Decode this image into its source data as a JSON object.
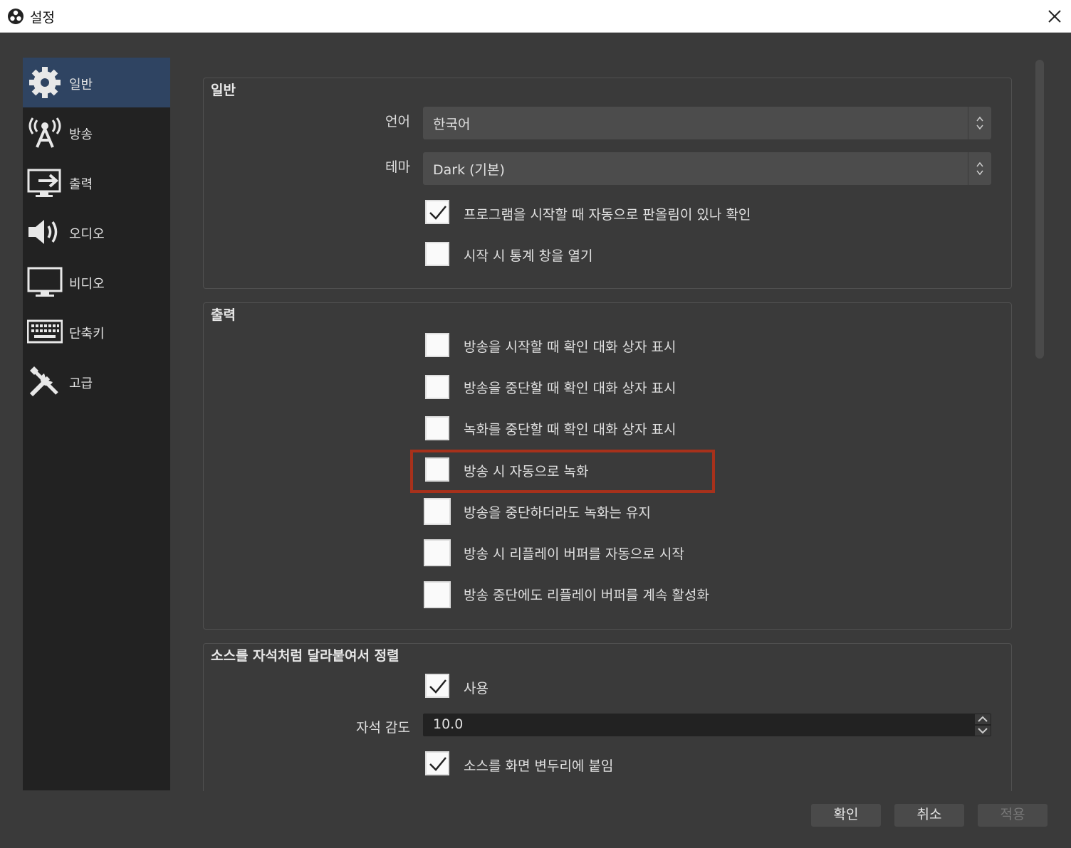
{
  "window": {
    "title": "설정"
  },
  "sidebar": {
    "items": [
      {
        "label": "일반",
        "icon": "gear-icon",
        "active": true
      },
      {
        "label": "방송",
        "icon": "broadcast-antenna-icon"
      },
      {
        "label": "출력",
        "icon": "output-monitor-icon"
      },
      {
        "label": "오디오",
        "icon": "speaker-icon"
      },
      {
        "label": "비디오",
        "icon": "monitor-icon"
      },
      {
        "label": "단축키",
        "icon": "keyboard-icon"
      },
      {
        "label": "고급",
        "icon": "tools-icon"
      }
    ]
  },
  "general": {
    "title": "일반",
    "language_label": "언어",
    "language_value": "한국어",
    "theme_label": "테마",
    "theme_value": "Dark (기본)",
    "check_update": {
      "label": "프로그램을 시작할 때 자동으로 판올림이 있나 확인",
      "checked": true
    },
    "open_stats": {
      "label": "시작 시 통계 창을 열기",
      "checked": false
    }
  },
  "output": {
    "title": "출력",
    "items": [
      {
        "label": "방송을 시작할 때 확인 대화 상자 표시",
        "checked": false
      },
      {
        "label": "방송을 중단할 때 확인 대화 상자 표시",
        "checked": false
      },
      {
        "label": "녹화를 중단할 때 확인 대화 상자 표시",
        "checked": false
      },
      {
        "label": "방송 시 자동으로 녹화",
        "checked": false
      },
      {
        "label": "방송을 중단하더라도 녹화는 유지",
        "checked": false
      },
      {
        "label": "방송 시 리플레이 버퍼를 자동으로 시작",
        "checked": false
      },
      {
        "label": "방송 중단에도 리플레이 버퍼를 계속 활성화",
        "checked": false
      }
    ]
  },
  "snapping": {
    "title": "소스를 자석처럼 달라붙여서 정렬",
    "enable": {
      "label": "사용",
      "checked": true
    },
    "sensitivity_label": "자석 감도",
    "sensitivity_value": "10.0",
    "snap_edges": {
      "label": "소스를 화면 변두리에 붙임",
      "checked": true
    }
  },
  "footer": {
    "ok": "확인",
    "cancel": "취소",
    "apply": "적용"
  },
  "colors": {
    "highlight": "#a7311b",
    "active_nav": "#2f4462"
  }
}
